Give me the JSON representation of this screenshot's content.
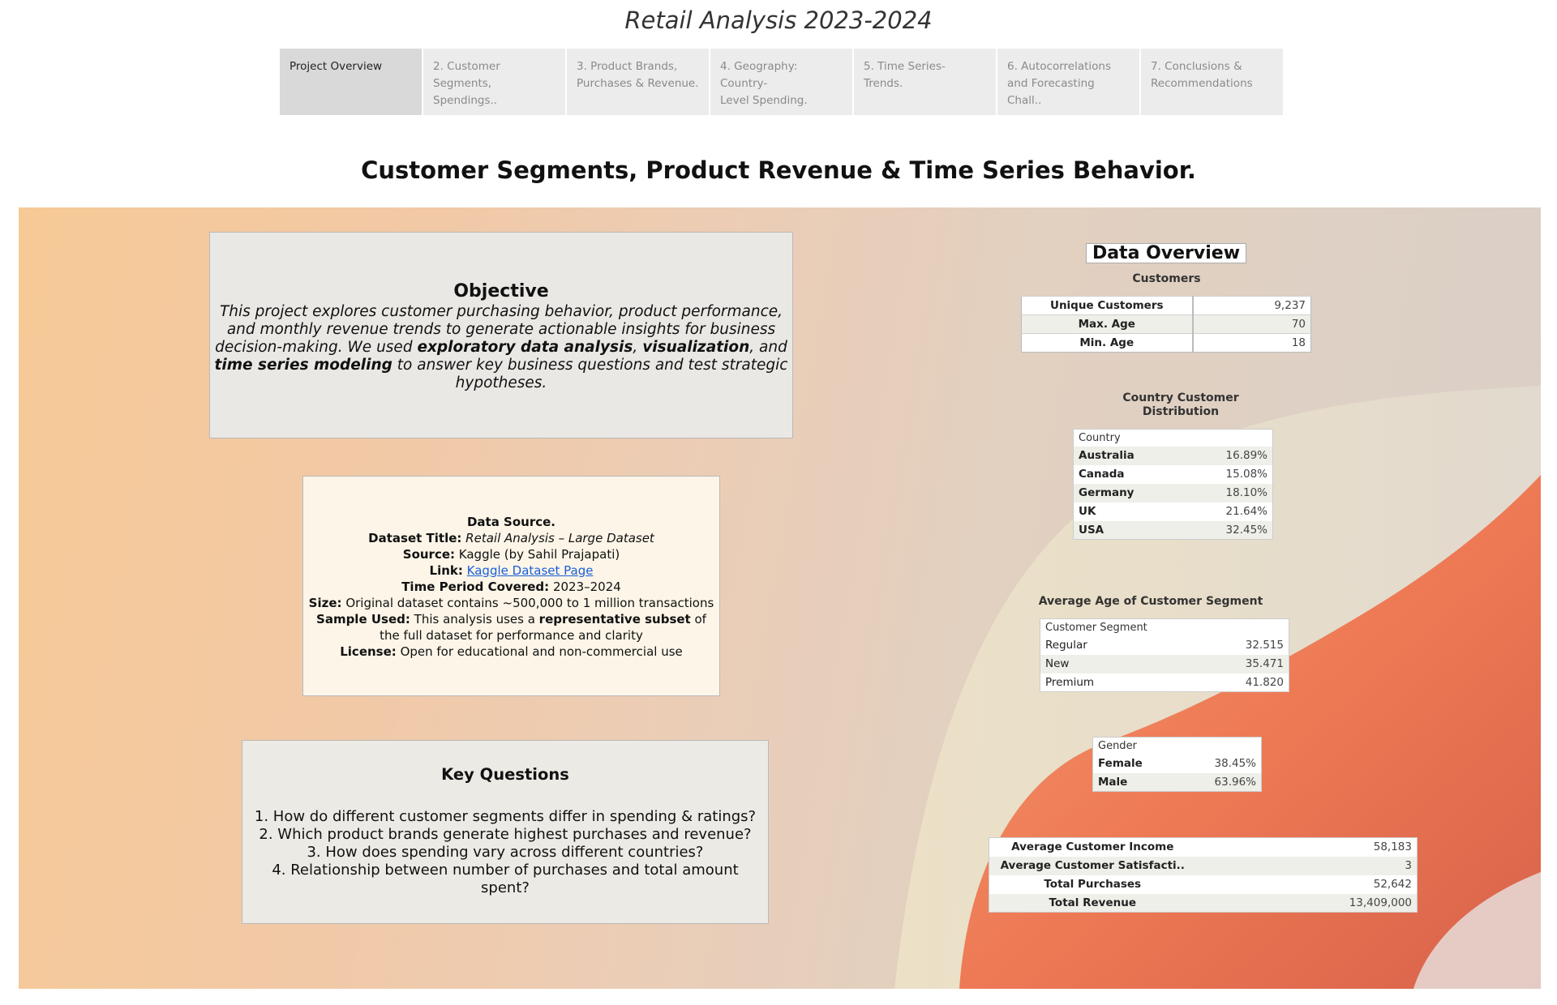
{
  "app": {
    "title": "Retail Analysis 2023-2024"
  },
  "tabs": [
    {
      "line1": "Project Overview",
      "line2": ""
    },
    {
      "line1": "2. Customer",
      "line2": "Segments, Spendings.."
    },
    {
      "line1": "3. Product Brands,",
      "line2": "Purchases & Revenue."
    },
    {
      "line1": "4. Geography: Country-",
      "line2": "Level Spending."
    },
    {
      "line1": "5. Time Series- Trends.",
      "line2": ""
    },
    {
      "line1": "6. Autocorrelations",
      "line2": "and Forecasting Chall.."
    },
    {
      "line1": "7. Conclusions &",
      "line2": "Recommendations"
    }
  ],
  "dashboard_title": "Customer Segments, Product Revenue & Time Series Behavior.",
  "objective": {
    "heading": "Objective",
    "text_1": "This project explores customer purchasing behavior, product performance, and monthly revenue trends to generate actionable insights for business decision-making. We used ",
    "bold_1": "exploratory data analysis",
    "sep_1": ", ",
    "bold_2": "visualization",
    "sep_2": ", and ",
    "bold_3": "time series modeling",
    "text_2": " to answer key business questions and test strategic hypotheses."
  },
  "data_source": {
    "heading": "Data Source.",
    "dataset_title_label": "Dataset Title:",
    "dataset_title_value": "Retail Analysis – Large Dataset",
    "source_label": "Source:",
    "source_value": "Kaggle (by Sahil Prajapati)",
    "link_label": "Link:",
    "link_text": "Kaggle Dataset Page",
    "period_label": "Time Period Covered:",
    "period_value": "2023–2024",
    "size_label": "Size:",
    "size_value": "Original dataset contains ~500,000 to 1 million transactions",
    "sample_label": "Sample Used:",
    "sample_value_1": "This analysis uses a ",
    "sample_bold": "representative subset",
    "sample_value_2": " of",
    "sample_value_3": "the full dataset for performance and clarity",
    "license_label": "License:",
    "license_value": "Open for educational and non-commercial use"
  },
  "key_questions": {
    "heading": "Key Questions",
    "items": [
      "1. How do different customer segments differ in spending & ratings?",
      "2. Which product brands generate highest purchases and revenue?",
      "3. How does spending vary across different countries?",
      "4. Relationship between number of purchases and total amount spent?"
    ]
  },
  "overview": {
    "title": "Data Overview",
    "customers_caption": "Customers",
    "customers": [
      {
        "label": "Unique Customers",
        "value": "9,237"
      },
      {
        "label": "Max. Age",
        "value": "70"
      },
      {
        "label": "Min. Age",
        "value": "18"
      }
    ],
    "country_caption_1": "Country Customer",
    "country_caption_2": "Distribution",
    "country_header": "Country",
    "countries": [
      {
        "label": "Australia",
        "value": "16.89%"
      },
      {
        "label": "Canada",
        "value": "15.08%"
      },
      {
        "label": "Germany",
        "value": "18.10%"
      },
      {
        "label": "UK",
        "value": "21.64%"
      },
      {
        "label": "USA",
        "value": "32.45%"
      }
    ],
    "segment_caption": "Average Age of Customer Segment",
    "segment_header": "Customer Segment",
    "segments": [
      {
        "label": "Regular",
        "value": "32.515"
      },
      {
        "label": "New",
        "value": "35.471"
      },
      {
        "label": "Premium",
        "value": "41.820"
      }
    ],
    "gender_header": "Gender",
    "genders": [
      {
        "label": "Female",
        "value": "38.45%"
      },
      {
        "label": "Male",
        "value": "63.96%"
      }
    ],
    "kpis": [
      {
        "label": "Average Customer Income",
        "value": "58,183"
      },
      {
        "label": "Average Customer Satisfacti..",
        "value": "3"
      },
      {
        "label": "Total Purchases",
        "value": "52,642"
      },
      {
        "label": "Total Revenue",
        "value": "13,409,000"
      }
    ]
  },
  "colors": {
    "link": "#1a5fd6",
    "tab_active": "#d9d9d9",
    "tab_inactive": "#ececec",
    "coral": "#f0805c"
  }
}
